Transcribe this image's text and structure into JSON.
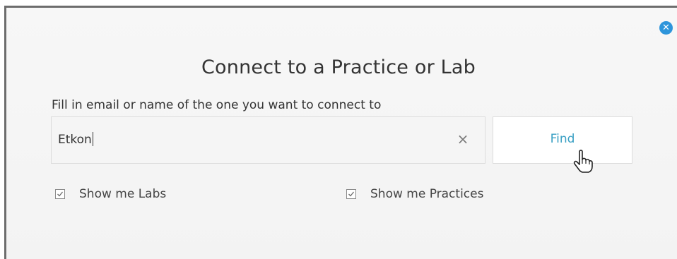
{
  "dialog": {
    "title": "Connect to a Practice or Lab",
    "subtitle": "Fill in email or name of the one you want to connect to",
    "close_icon": "close-circle-icon",
    "accent_color": "#2e95db"
  },
  "search": {
    "value": "Etkon",
    "clear_icon": "×"
  },
  "find_button": {
    "label": "Find",
    "color": "#3aa0c4"
  },
  "options": {
    "show_labs": {
      "label": "Show me Labs",
      "checked": true
    },
    "show_practices": {
      "label": "Show me Practices",
      "checked": true
    }
  }
}
